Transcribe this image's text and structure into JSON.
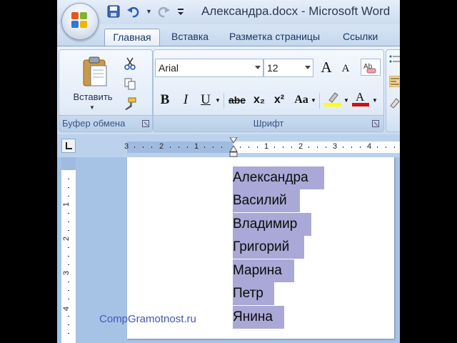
{
  "window": {
    "title": "Александра.docx - Microsoft Word"
  },
  "tabs": [
    {
      "label": "Главная",
      "active": true
    },
    {
      "label": "Вставка"
    },
    {
      "label": "Разметка страницы"
    },
    {
      "label": "Ссылки"
    }
  ],
  "quick_access": {
    "icons": [
      "save-icon",
      "undo-icon",
      "redo-icon",
      "customize-icon"
    ]
  },
  "clipboard_group": {
    "label": "Буфер обмена",
    "paste_label": "Вставить"
  },
  "font_group": {
    "label": "Шрифт",
    "font_name": "Arial",
    "font_size": "12",
    "bold": "B",
    "italic": "I",
    "underline": "U",
    "strikethrough": "abe",
    "subscript": "x₂",
    "superscript": "x²",
    "change_case": "Aa",
    "grow_font": "A",
    "shrink_font": "A",
    "highlight_color": "#ffff00",
    "font_color": "#d01010"
  },
  "ruler": {
    "numbers": [
      "3",
      "2",
      "1",
      "1",
      "1",
      "2",
      "3",
      "4"
    ],
    "vertical_numbers": [
      "1",
      "2",
      "3",
      "4"
    ]
  },
  "document": {
    "lines": [
      "Александра",
      "Василий",
      "Владимир",
      "Григорий",
      "Марина",
      "Петр",
      "Янина"
    ],
    "selection_color": "#a9a8d6"
  },
  "watermark": "CompGramotnost.ru"
}
